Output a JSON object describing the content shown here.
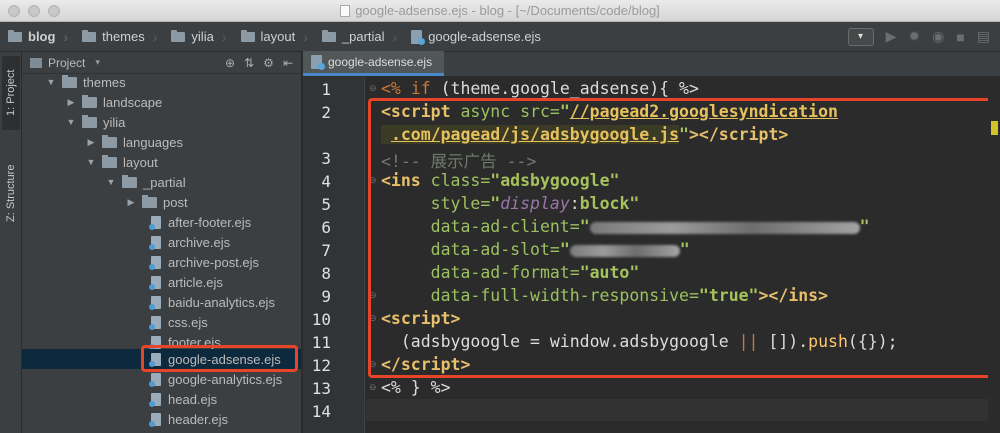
{
  "window": {
    "title": "google-adsense.ejs - blog - [~/Documents/code/blog]"
  },
  "breadcrumb": [
    "blog",
    "themes",
    "yilia",
    "layout",
    "_partial",
    "google-adsense.ejs"
  ],
  "toolbar": {
    "run_config": "▾"
  },
  "left_tabs": [
    "1: Project",
    "Z: Structure"
  ],
  "project_panel": {
    "title": "Project",
    "tree": [
      {
        "label": "themes",
        "type": "folder",
        "expanded": true
      },
      {
        "label": "landscape",
        "type": "folder",
        "expanded": false
      },
      {
        "label": "yilia",
        "type": "folder",
        "expanded": true
      },
      {
        "label": "languages",
        "type": "folder",
        "expanded": false
      },
      {
        "label": "layout",
        "type": "folder",
        "expanded": true
      },
      {
        "label": "_partial",
        "type": "folder",
        "expanded": true
      },
      {
        "label": "post",
        "type": "folder",
        "expanded": false
      },
      {
        "label": "after-footer.ejs",
        "type": "file"
      },
      {
        "label": "archive.ejs",
        "type": "file"
      },
      {
        "label": "archive-post.ejs",
        "type": "file"
      },
      {
        "label": "article.ejs",
        "type": "file"
      },
      {
        "label": "baidu-analytics.ejs",
        "type": "file"
      },
      {
        "label": "css.ejs",
        "type": "file"
      },
      {
        "label": "footer.ejs",
        "type": "file"
      },
      {
        "label": "google-adsense.ejs",
        "type": "file",
        "selected": true
      },
      {
        "label": "google-analytics.ejs",
        "type": "file"
      },
      {
        "label": "head.ejs",
        "type": "file"
      },
      {
        "label": "header.ejs",
        "type": "file"
      }
    ]
  },
  "editor": {
    "tab_label": "google-adsense.ejs",
    "line_numbers": [
      "1",
      "2",
      "3",
      "4",
      "5",
      "6",
      "7",
      "8",
      "9",
      "10",
      "11",
      "12",
      "13",
      "14"
    ],
    "code": {
      "l1a": "<% ",
      "l1b": "if",
      "l1c": " (theme.google_adsense){ %>",
      "l2a": "<script",
      "l2b": " async src=",
      "l2c": "\"",
      "l2d": "//pagead2.googlesyndication",
      "l2e": ".com/pagead/js/adsbygoogle.js",
      "l2f": "\"",
      "l2g": "></",
      "l2h": "script",
      "l2i": ">",
      "l3": "<!-- 展示广告 -->",
      "l4a": "<ins",
      "l4b": " class=",
      "l4c": "\"adsbygoogle\"",
      "l5a": "     style=",
      "l5b": "\"",
      "l5c": "display",
      "l5d": ":",
      "l5e": "block",
      "l5f": "\"",
      "l6a": "     data-ad-client=",
      "l6b": "\"",
      "l6c": "\"",
      "l7a": "     data-ad-slot=",
      "l7b": "\"",
      "l7c": "\"",
      "l8a": "     data-ad-format=",
      "l8b": "\"auto\"",
      "l9a": "     data-full-width-responsive=",
      "l9b": "\"true\"",
      "l9c": "></",
      "l9d": "ins",
      "l9e": ">",
      "l10a": "<script",
      "l10b": ">",
      "l11a": "  (adsbygoogle = window.adsbygoogle ",
      "l11b": "||",
      "l11c": " []).",
      "l11d": "push",
      "l11e": "({});",
      "l12a": "</",
      "l12b": "script",
      "l12c": ">",
      "l13": "<% } %>"
    }
  }
}
